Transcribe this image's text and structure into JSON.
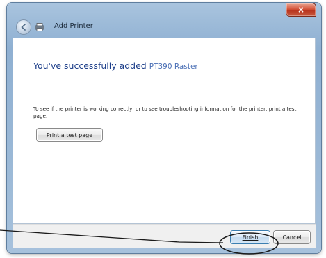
{
  "window": {
    "title": "Add Printer",
    "close_glyph": "×"
  },
  "icons": {
    "back": "back-arrow-icon",
    "printer": "printer-icon",
    "close": "close-icon"
  },
  "content": {
    "headline": "You've successfully added",
    "printer_name": "PT390 Raster",
    "body": "To see if the printer is working correctly, or to see troubleshooting information for the printer, print a test page.",
    "print_test_label": "Print a test page"
  },
  "footer": {
    "finish_label": "Finish",
    "cancel_label": "Cancel"
  },
  "colors": {
    "headline": "#1e3f8a",
    "printer_name": "#4a6fb5",
    "close": "#c84a31",
    "callout": "#1a1a1a"
  }
}
